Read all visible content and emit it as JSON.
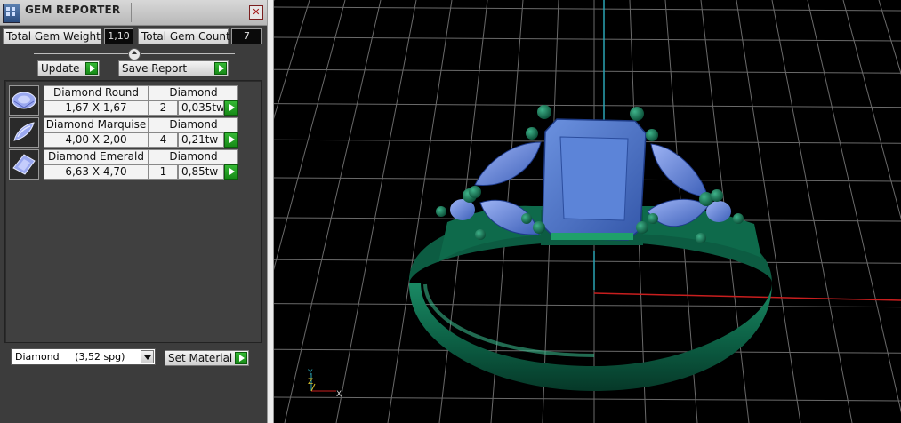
{
  "panel": {
    "title": "GEM REPORTER",
    "close_label": "✕",
    "total_weight_label": "Total Gem Weight",
    "total_weight_value": "1,10",
    "total_count_label": "Total Gem Count",
    "total_count_value": "7",
    "update_label": "Update",
    "save_report_label": "Save Report",
    "gems": [
      {
        "name": "Diamond Round",
        "material": "Diamond",
        "size": "1,67 X 1,67",
        "count": "2",
        "weight": "0,035tw",
        "icon": "round-gem-icon"
      },
      {
        "name": "Diamond Marquise",
        "material": "Diamond",
        "size": "4,00 X 2,00",
        "count": "4",
        "weight": "0,21tw",
        "icon": "marquise-gem-icon"
      },
      {
        "name": "Diamond Emerald",
        "material": "Diamond",
        "size": "6,63 X 4,70",
        "count": "1",
        "weight": "0,85tw",
        "icon": "emerald-gem-icon"
      }
    ],
    "material_select": {
      "name": "Diamond",
      "spg": "(3,52 spg)"
    },
    "set_material_label": "Set Material"
  },
  "viewport": {
    "axis_labels": {
      "y": "Y",
      "z": "Z",
      "x": "X"
    },
    "colors": {
      "metal": "#0f6a4a",
      "gem": "#4a74c8",
      "grid": "#8a8a8a",
      "x_axis": "#c81e1e",
      "y_axis": "#2aa4b4"
    }
  }
}
